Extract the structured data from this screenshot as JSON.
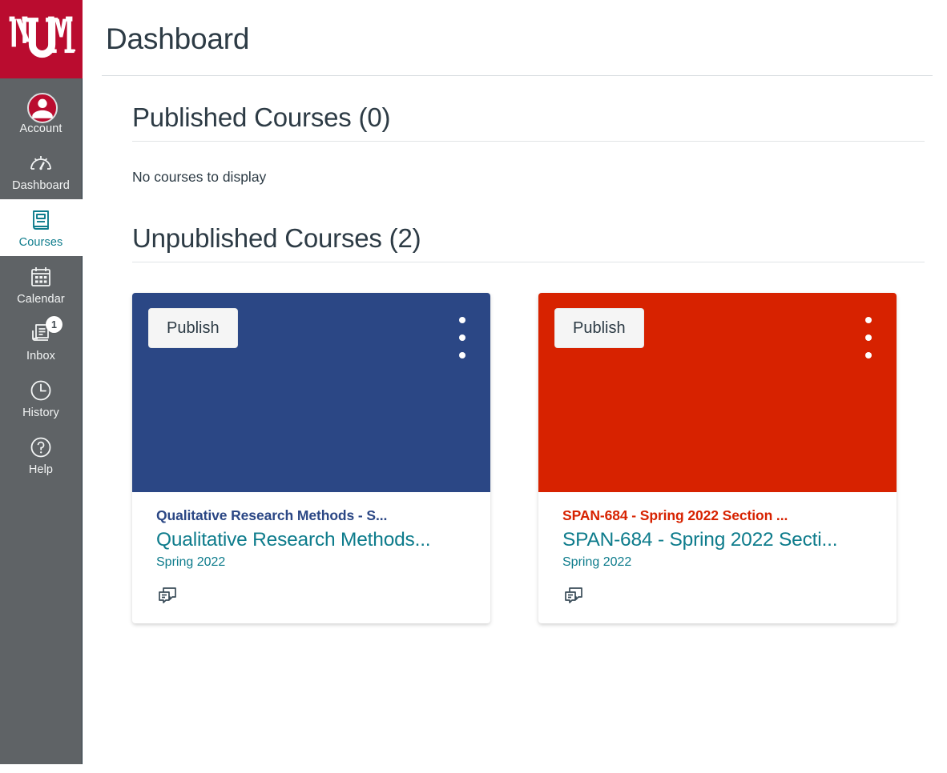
{
  "brand": {
    "logo_text": "UNM",
    "logo_bg": "#BA0C2F",
    "sidebar_bg": "#5F6366",
    "link_teal": "#0E7C8C"
  },
  "sidebar": {
    "items": [
      {
        "label": "Account",
        "icon": "user-avatar-icon",
        "active": false,
        "badge": null
      },
      {
        "label": "Dashboard",
        "icon": "speedometer-icon",
        "active": false,
        "badge": null
      },
      {
        "label": "Courses",
        "icon": "book-icon",
        "active": true,
        "badge": null
      },
      {
        "label": "Calendar",
        "icon": "calendar-icon",
        "active": false,
        "badge": null
      },
      {
        "label": "Inbox",
        "icon": "inbox-icon",
        "active": false,
        "badge": "1"
      },
      {
        "label": "History",
        "icon": "clock-icon",
        "active": false,
        "badge": null
      },
      {
        "label": "Help",
        "icon": "question-circle-icon",
        "active": false,
        "badge": null
      }
    ]
  },
  "header": {
    "title": "Dashboard"
  },
  "published_section": {
    "heading": "Published Courses (0)",
    "empty_message": "No courses to display"
  },
  "unpublished_section": {
    "heading": "Unpublished Courses (2)",
    "cards": [
      {
        "header_color": "#2B4785",
        "publish_label": "Publish",
        "menu_icon": "kebab-menu-icon",
        "code": "Qualitative Research Methods - S...",
        "code_color": "#2B4785",
        "name": "Qualitative Research Methods...",
        "term": "Spring 2022",
        "icons": [
          "discussions-icon"
        ]
      },
      {
        "header_color": "#D72200",
        "publish_label": "Publish",
        "menu_icon": "kebab-menu-icon",
        "code": "SPAN-684 - Spring 2022 Section ...",
        "code_color": "#D72200",
        "name": "SPAN-684 - Spring 2022 Secti...",
        "term": "Spring 2022",
        "icons": [
          "discussions-icon"
        ]
      }
    ]
  }
}
